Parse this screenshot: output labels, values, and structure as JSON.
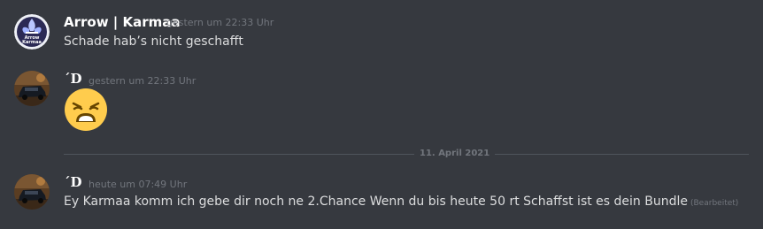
{
  "messages": [
    {
      "author": "Arrow | Karmaa",
      "timestamp": "gestern um 22:33 Uhr",
      "content": "Schade hab’s nicht geschafft",
      "avatar_text_top": "Arrow",
      "avatar_text_bottom": "Karmaa"
    },
    {
      "author": "´D",
      "timestamp": "gestern um 22:33 Uhr",
      "emoji": "weary-face"
    },
    {
      "author": "´D",
      "timestamp": "heute um 07:49 Uhr",
      "content": "Ey Karmaa komm ich gebe dir noch ne 2.Chance Wenn du bis heute 50 rt Schaffst ist es dein Bundle",
      "edited_label": "(Bearbeitet)"
    }
  ],
  "date_divider": "11. April 2021",
  "colors": {
    "background": "#36393f",
    "text": "#dcddde",
    "author": "#ffffff",
    "muted": "#72767d",
    "divider": "#4f545c"
  },
  "icons": [
    "fleur-de-lis-logo-icon",
    "car-avatar-icon",
    "weary-face-emoji-icon"
  ]
}
